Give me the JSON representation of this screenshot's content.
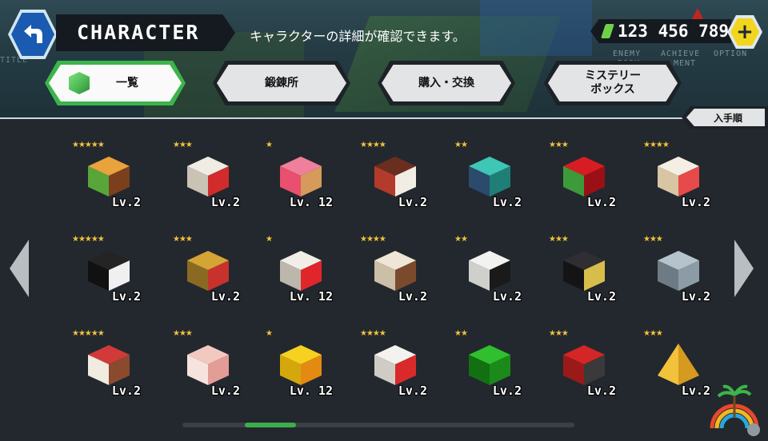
{
  "header": {
    "title": "CHARACTER",
    "subtitle": "キャラクターの詳細が確認できます。",
    "currency_value": "123 456 789",
    "ghost_left": "TITLE",
    "nav_hints": [
      "ENEMY",
      "ACHIEVE",
      "OPTION"
    ],
    "nav_hints2": [
      "BOOK",
      "MENT"
    ]
  },
  "tabs": [
    {
      "label": "一覧",
      "active": true
    },
    {
      "label": "鍛錬所",
      "active": false
    },
    {
      "label": "購入・交換",
      "active": false
    },
    {
      "label": "ミステリー\nボックス",
      "active": false
    }
  ],
  "sort_label": "入手順",
  "characters": [
    {
      "name": "hamburger-icon",
      "stars": "★★★★★",
      "level": "Lv.2"
    },
    {
      "name": "gift-box-icon",
      "stars": "★★★",
      "level": "Lv.2"
    },
    {
      "name": "donut-icon",
      "stars": "★",
      "level": "Lv. 12"
    },
    {
      "name": "chocolate-cake-icon",
      "stars": "★★★★",
      "level": "Lv.2"
    },
    {
      "name": "teal-robot-icon",
      "stars": "★★",
      "level": "Lv.2"
    },
    {
      "name": "apple-icon",
      "stars": "★★★",
      "level": "Lv.2"
    },
    {
      "name": "strawberry-shortcake-icon",
      "stars": "★★★★",
      "level": "Lv.2"
    },
    {
      "name": "cow-icon",
      "stars": "★★★★★",
      "level": "Lv.2"
    },
    {
      "name": "hay-bale-icon",
      "stars": "★★★",
      "level": "Lv.2"
    },
    {
      "name": "sushi-roll-icon",
      "stars": "★",
      "level": "Lv. 12"
    },
    {
      "name": "coffee-cup-icon",
      "stars": "★★★★",
      "level": "Lv.2"
    },
    {
      "name": "panda-icon",
      "stars": "★★",
      "level": "Lv.2"
    },
    {
      "name": "laptop-icon",
      "stars": "★★★",
      "level": "Lv.2"
    },
    {
      "name": "elephant-icon",
      "stars": "★★★",
      "level": "Lv.2"
    },
    {
      "name": "strawberry-cake-icon",
      "stars": "★★★★★",
      "level": "Lv.2"
    },
    {
      "name": "rabbit-icon",
      "stars": "★★★",
      "level": "Lv.2"
    },
    {
      "name": "chick-icon",
      "stars": "★",
      "level": "Lv. 12"
    },
    {
      "name": "chicken-icon",
      "stars": "★★★★",
      "level": "Lv.2"
    },
    {
      "name": "frog-icon",
      "stars": "★★",
      "level": "Lv.2"
    },
    {
      "name": "tv-icon",
      "stars": "★★★",
      "level": "Lv.2"
    },
    {
      "name": "pyramid-icon",
      "stars": "★★★",
      "level": "Lv.2"
    }
  ],
  "colors": {
    "accent_green": "#3bb54a",
    "star_gold": "#f2c33a",
    "back_blue": "#1a5ab0",
    "plus_yellow": "#f2d51e"
  }
}
